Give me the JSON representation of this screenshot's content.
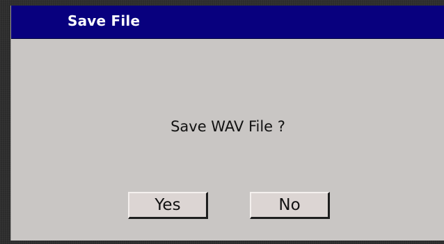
{
  "dialog": {
    "title": "Save File",
    "message": "Save WAV File ?",
    "buttons": {
      "yes_label": "Yes",
      "no_label": "No"
    }
  },
  "colors": {
    "titlebar": "#08007e",
    "title_text": "#ffffff",
    "dialog_bg": "#c9c6c4",
    "button_bg": "#dcd5d3"
  }
}
